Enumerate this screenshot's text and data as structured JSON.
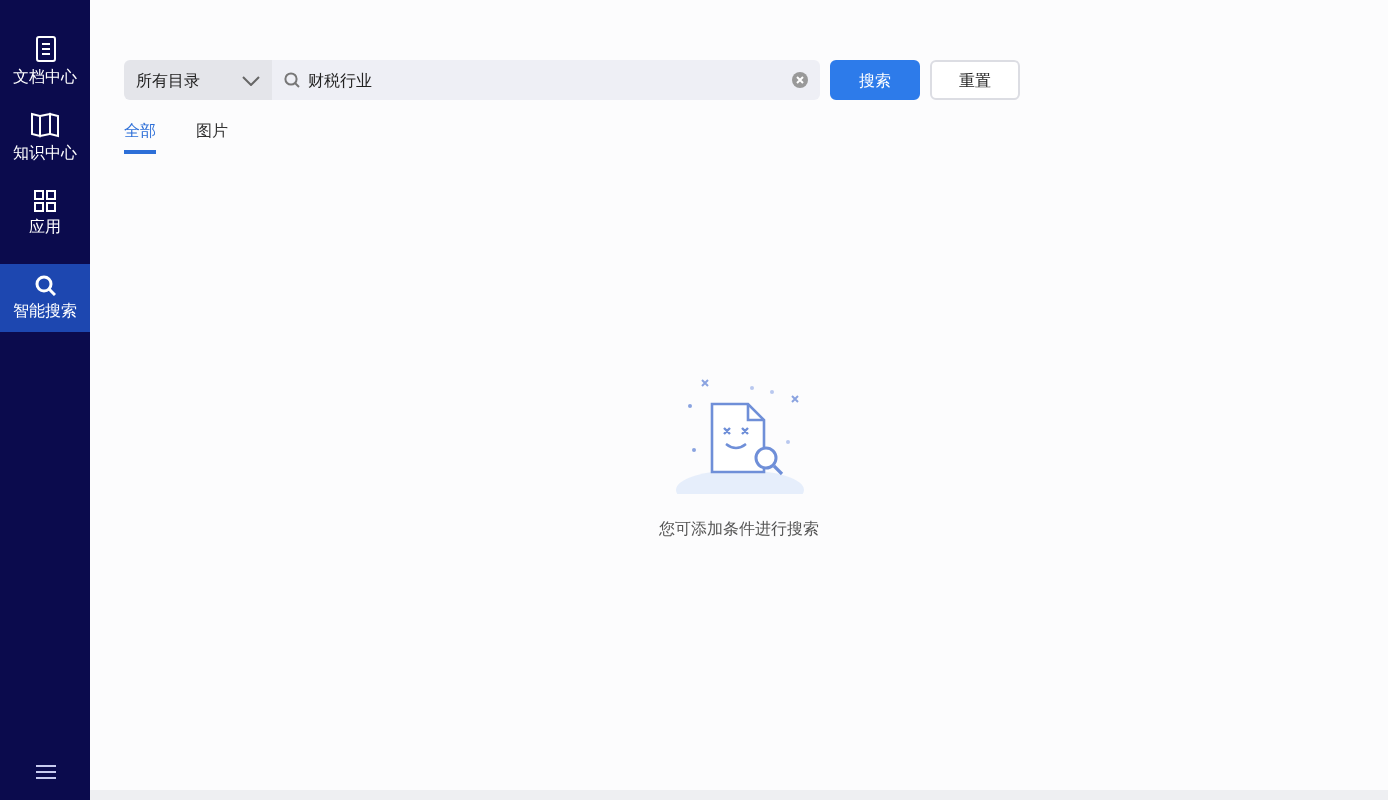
{
  "sidebar": {
    "items": [
      {
        "label": "文档中心",
        "kind": "doc",
        "selected": false
      },
      {
        "label": "知识中心",
        "kind": "book",
        "selected": false
      },
      {
        "label": "应用",
        "kind": "grid",
        "selected": false
      },
      {
        "label": "智能搜索",
        "kind": "search",
        "selected": true
      }
    ]
  },
  "search": {
    "scope": "所有目录",
    "value": "财税行业",
    "buttons": [
      "搜索",
      "重置"
    ]
  },
  "tabs": [
    {
      "label": "全部",
      "selected": true
    },
    {
      "label": "图片",
      "selected": false
    }
  ],
  "empty_state": {
    "message": "您可添加条件进行搜索"
  }
}
